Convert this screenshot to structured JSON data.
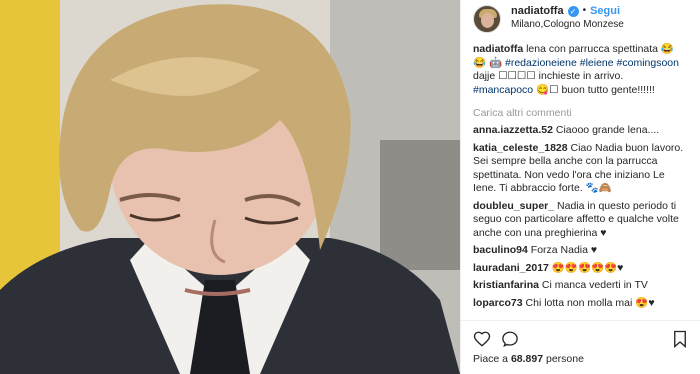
{
  "post": {
    "username": "nadiatoffa",
    "follow_label": "Segui",
    "location": "Milano,Cologno Monzese",
    "caption": {
      "username": "nadiatoffa",
      "text_1": "lena con parrucca spettinata 😂",
      "text_2": "😂 🤖",
      "tag_1": "#redazioneiene",
      "tag_2": "#leiene",
      "tag_3": "#comingsoon",
      "text_3": "dajje ☐☐☐☐ inchieste in arrivo.",
      "tag_4": "#mancapoco",
      "text_4": "😋☐ buon tutto gente!!!!!!"
    },
    "load_more": "Carica altri commenti",
    "comments": [
      {
        "user": "anna.iazzetta.52",
        "text": "Ciaooo grande lena...."
      },
      {
        "user": "katia_celeste_1828",
        "text": "Ciao Nadia buon lavoro. Sei sempre bella anche con la parrucca spettinata. Non vedo l'ora che iniziano Le Iene. Ti abbraccio forte. 🐾🙈"
      },
      {
        "user": "doubleu_super_",
        "text": "Nadia in questo periodo ti seguo con particolare affetto e qualche volte anche con una preghierina ♥"
      },
      {
        "user": "baculino94",
        "text": "Forza Nadia ♥"
      },
      {
        "user": "lauradani_2017",
        "text": "😍😍😍😍😍♥"
      },
      {
        "user": "kristianfarina",
        "text": "Ci manca vederti in TV"
      },
      {
        "user": "loparco73",
        "text": "Chi lotta non molla mai 😍♥"
      }
    ],
    "likes_prefix": "Piace a",
    "likes_count": "68.897",
    "likes_suffix": "persone",
    "icons": {
      "like": "heart-icon",
      "comment": "comment-icon",
      "save": "bookmark-icon"
    },
    "colors": {
      "link": "#3897f0",
      "hashtag": "#003569",
      "muted": "#999999"
    }
  }
}
